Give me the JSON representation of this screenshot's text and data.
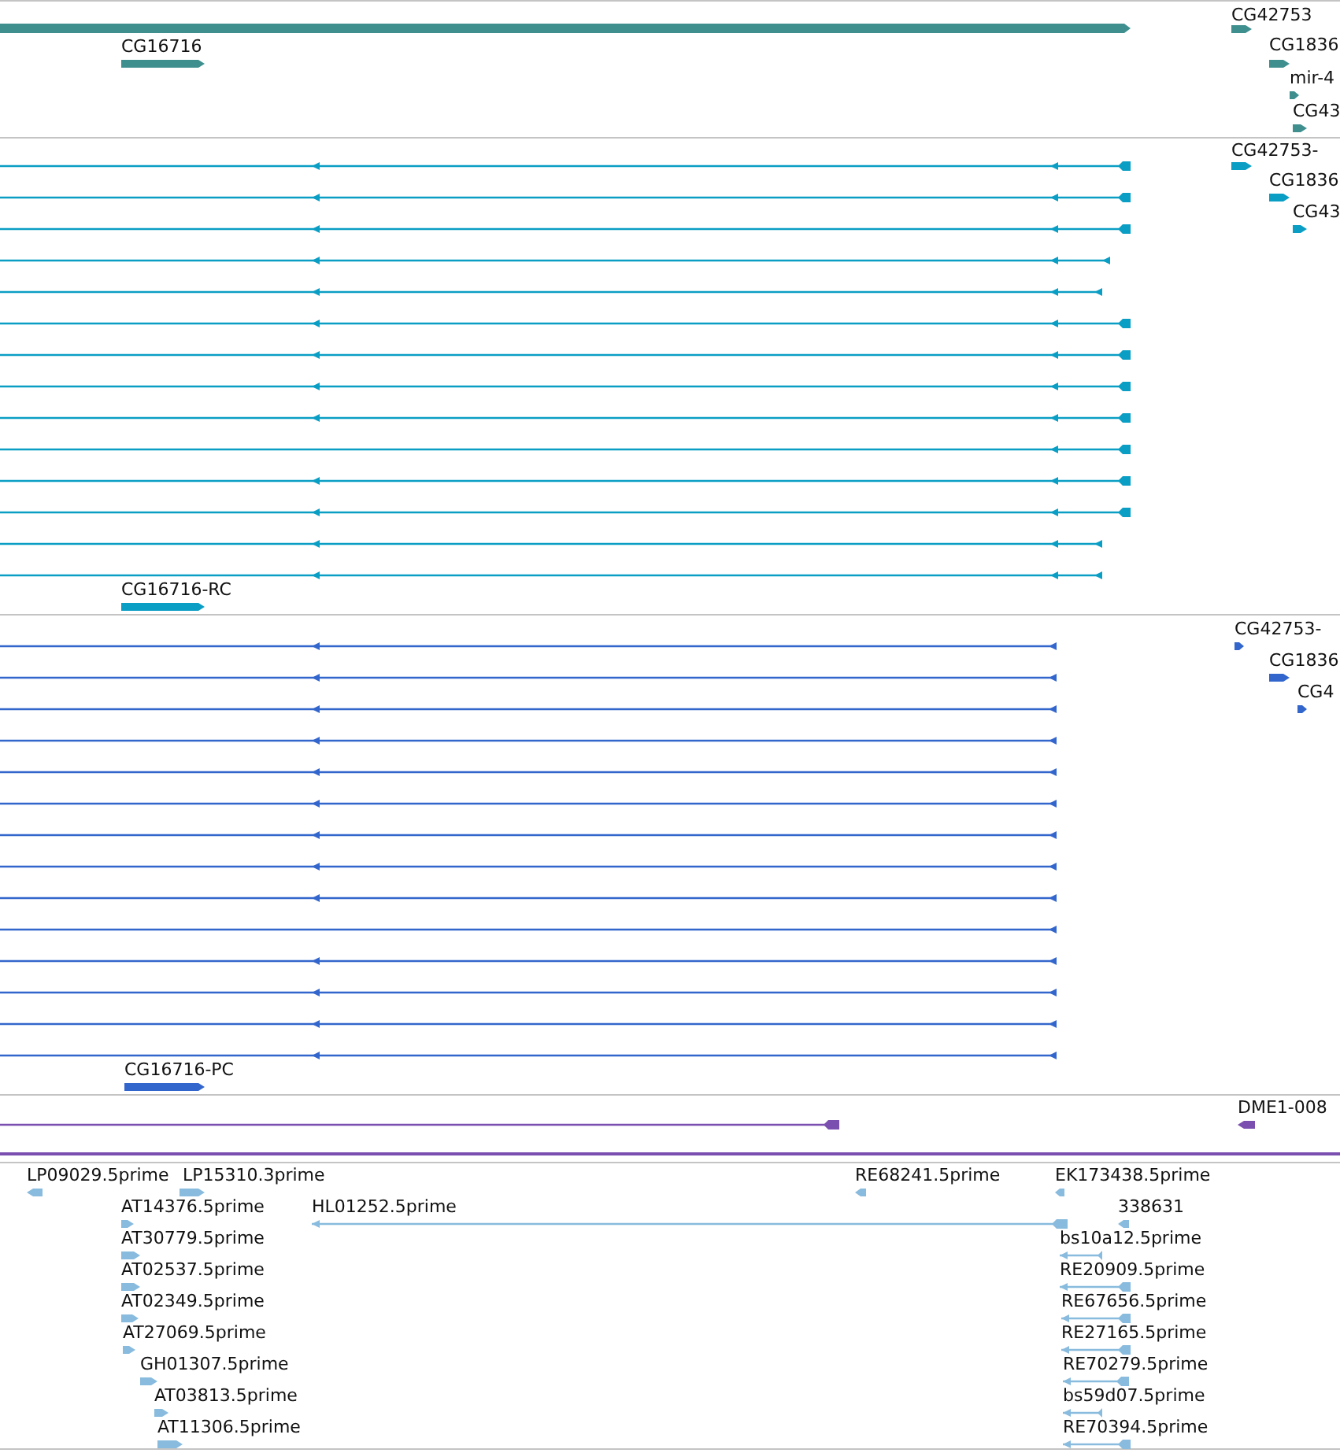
{
  "tracks": [
    {
      "kind": "gene",
      "features": [
        {
          "label": "CG16716"
        },
        {
          "label": "CG42753"
        },
        {
          "label": "CG1836"
        },
        {
          "label": "mir-4"
        },
        {
          "label": "CG43"
        }
      ]
    },
    {
      "kind": "transcript",
      "features": [
        {
          "label": "CG16716-RC"
        },
        {
          "label": "CG42753-"
        },
        {
          "label": "CG1836"
        },
        {
          "label": "CG43"
        }
      ]
    },
    {
      "kind": "protein",
      "features": [
        {
          "label": "CG16716-PC"
        },
        {
          "label": "CG42753-"
        },
        {
          "label": "CG1836"
        },
        {
          "label": "CG4"
        }
      ]
    },
    {
      "kind": "repeat",
      "features": [
        {
          "label": "DME1-008"
        }
      ]
    },
    {
      "kind": "est",
      "features": [
        {
          "label": "LP09029.5prime"
        },
        {
          "label": "LP15310.3prime"
        },
        {
          "label": "RE68241.5prime"
        },
        {
          "label": "EK173438.5prime"
        },
        {
          "label": "AT14376.5prime"
        },
        {
          "label": "HL01252.5prime"
        },
        {
          "label": "338631"
        },
        {
          "label": "AT30779.5prime"
        },
        {
          "label": "bs10a12.5prime"
        },
        {
          "label": "AT02537.5prime"
        },
        {
          "label": "RE20909.5prime"
        },
        {
          "label": "AT02349.5prime"
        },
        {
          "label": "RE67656.5prime"
        },
        {
          "label": "AT27069.5prime"
        },
        {
          "label": "RE27165.5prime"
        },
        {
          "label": "GH01307.5prime"
        },
        {
          "label": "RE70279.5prime"
        },
        {
          "label": "AT03813.5prime"
        },
        {
          "label": "bs59d07.5prime"
        },
        {
          "label": "AT11306.5prime"
        },
        {
          "label": "RE70394.5prime"
        }
      ]
    }
  ]
}
